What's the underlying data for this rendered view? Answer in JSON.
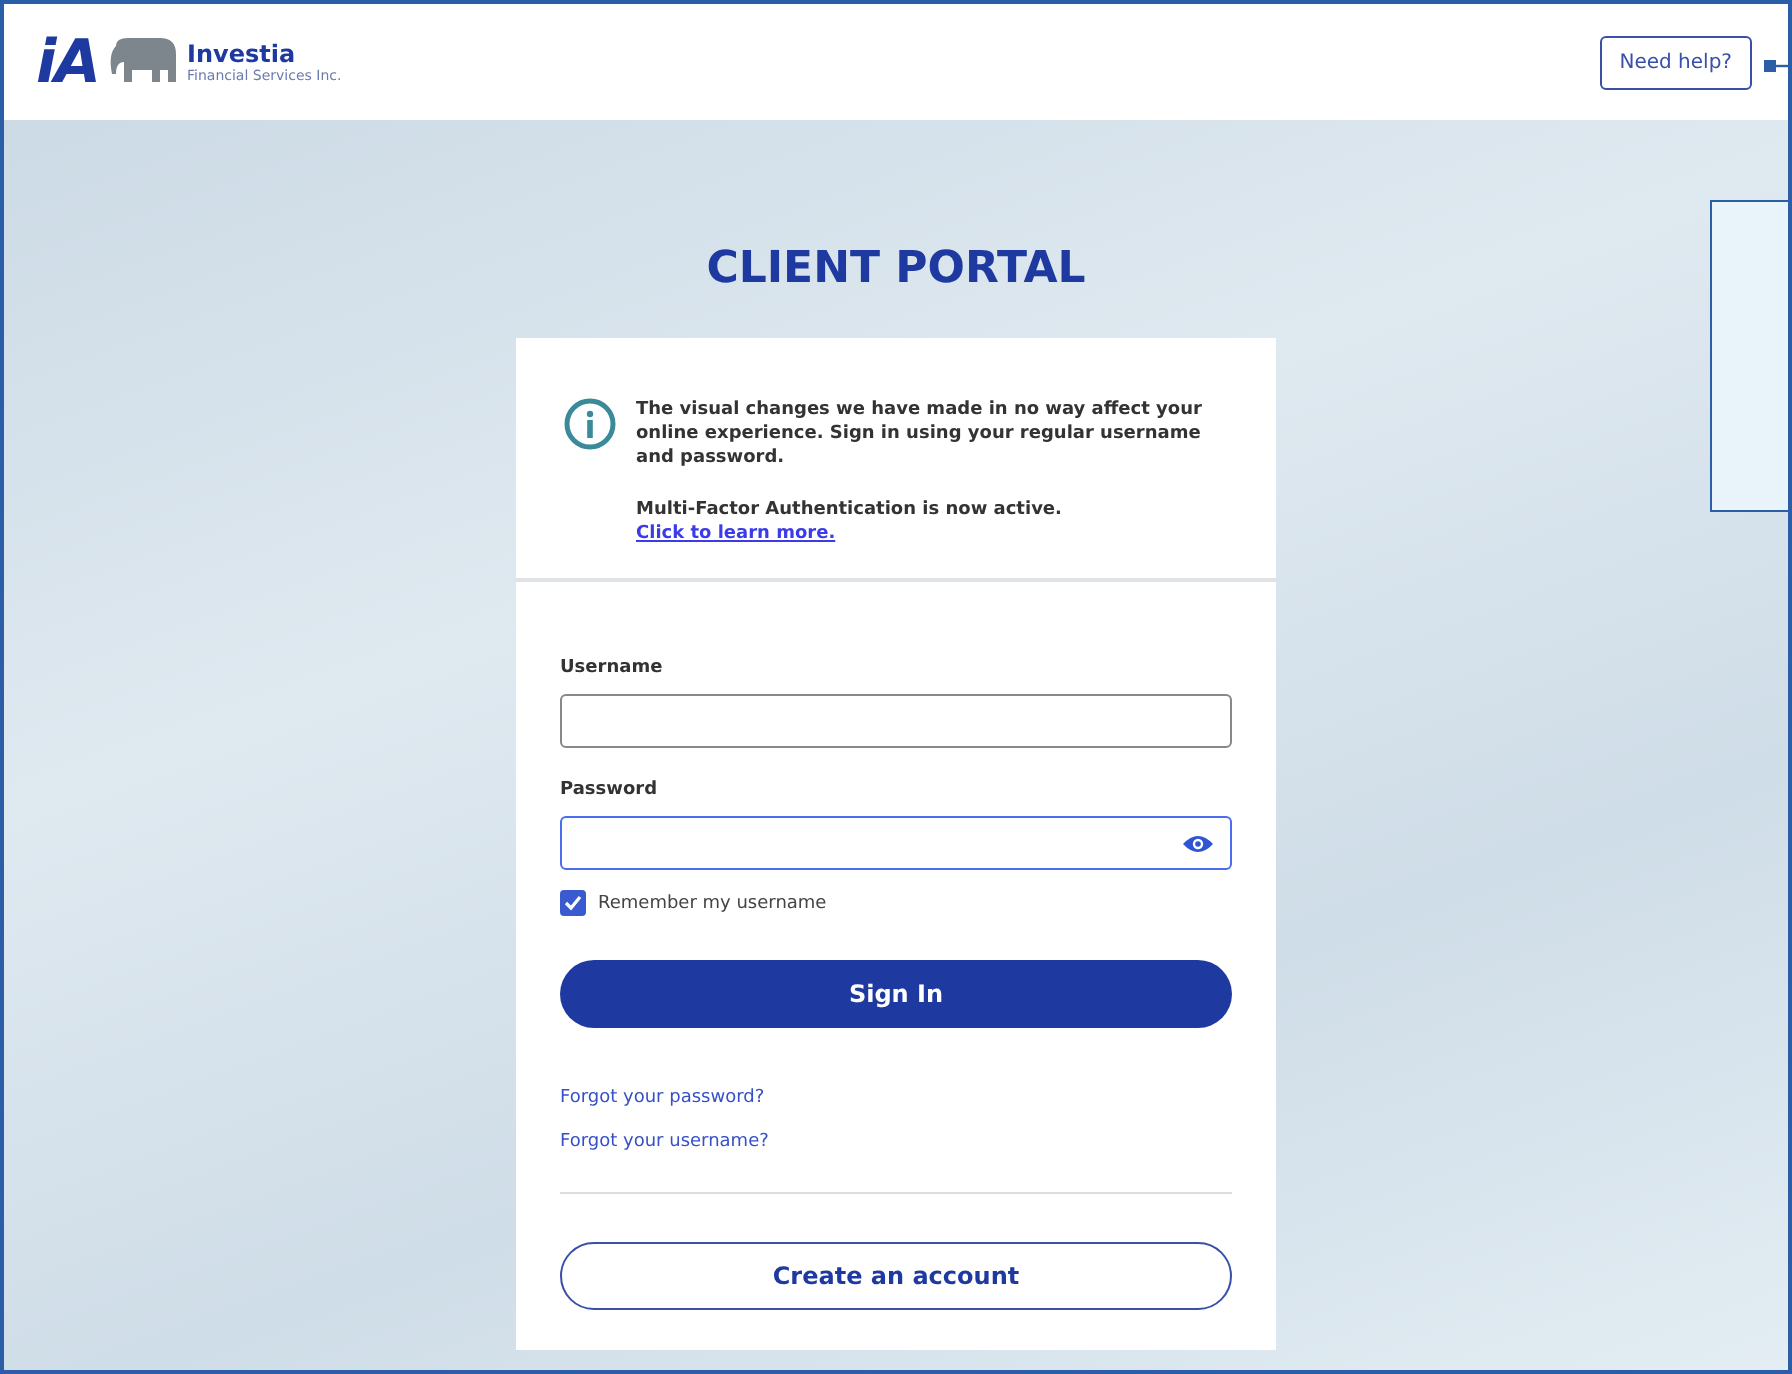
{
  "header": {
    "brand_mark": "iA",
    "brand_name": "Investia",
    "brand_sub": "Financial Services Inc.",
    "help_button": "Need help?"
  },
  "title": "CLIENT PORTAL",
  "notice": {
    "message": "The visual changes we have made in no way affect your online experience. Sign in using your regular username and password.",
    "mfa_text": "Multi-Factor Authentication is now active.",
    "mfa_link": "Click to learn more."
  },
  "form": {
    "username": {
      "label": "Username",
      "focused": false
    },
    "password": {
      "label": "Password",
      "focused": true
    },
    "remember": {
      "label": "Remember my username",
      "checked": true
    },
    "sign_in": "Sign In",
    "links": [
      "Forgot your password?",
      "Forgot your username?"
    ],
    "create_account": "Create an account"
  }
}
